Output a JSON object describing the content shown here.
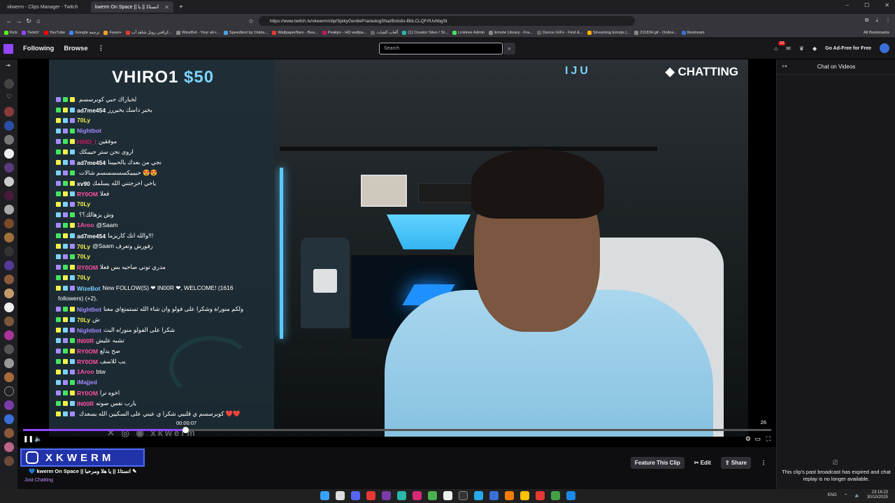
{
  "browser": {
    "tabs": [
      {
        "label": "xkwerm - Clips Manager - Twitch",
        "active": false
      },
      {
        "label": "kwerm On Space || انستا1 || يا",
        "active": true
      }
    ],
    "url": "https://www.twitch.tv/xkwerm/clip/SpikyGentlePrariedogShazBotstix-BbLCLQFrfUvhbgSt",
    "bookmarks": [
      "Kick",
      "Twitch'",
      "YouTube",
      "Google ترجمة",
      "Fasel+",
      "كرافتي روبل شاهد أب...",
      "WizeBot - Your all-i...",
      "Speedtest by Ookla...",
      "Wallpaperflare - Bea...",
      "Peakpx - HD wallpa...",
      "ألعاب الشات",
      "(1) Creator Sites / St...",
      "Linktree Admin",
      "Emote Library - Fra...",
      "Dance GIFs - Find &...",
      "Streaming Emojis |...",
      "211834.gif - Online...",
      "Restream"
    ],
    "all_bookmarks": "All Bookmarks"
  },
  "twitch_nav": {
    "following": "Following",
    "browse": "Browse",
    "more": "⋮",
    "search_placeholder": "Search",
    "notifications_count": "10",
    "ad_free": "Go Ad-Free for Free"
  },
  "overlay": {
    "title_name": "VHIRO1",
    "title_amount": "$50",
    "chatting_label": "CHATTING",
    "corner_mark": "IJU",
    "watermark": "xkwerm"
  },
  "chat_lines": [
    {
      "user": "",
      "msg": "لخباراك حبي كوبرسسم",
      "color": "#c2185b"
    },
    {
      "user": "ad7me454",
      "msg": "يخير داسك يخيررر",
      "color": "#ffffff"
    },
    {
      "user": "70Ly",
      "msg": "",
      "color": "#f2f24a"
    },
    {
      "user": "Nightbot",
      "msg": "",
      "color": "#a48bff"
    },
    {
      "user": "HIND_I",
      "msg": "موفقين",
      "color": "#c2185b"
    },
    {
      "user": "",
      "msg": "اروى نحن ستر حبيبكك",
      "color": "#c2185b"
    },
    {
      "user": "ad7me454",
      "msg": "نجي من بعدك يالحبيبنا",
      "color": "#ffffff"
    },
    {
      "user": "",
      "msg": "حبيبيكسسسسسم شالات 😍😍",
      "color": "#c2185b"
    },
    {
      "user": "xv90",
      "msg": "ياخي اخرجتني الله يسلمك",
      "color": "#ffffff"
    },
    {
      "user": "RY0OM",
      "msg": "فعلا",
      "color": "#ff4fa3"
    },
    {
      "user": "70Ly",
      "msg": "",
      "color": "#f2f24a"
    },
    {
      "user": "",
      "msg": "وش يزهالك؟؟",
      "color": "#c2185b"
    },
    {
      "user": "1Aroo",
      "msg": "@Saam",
      "color": "#ff4fa3"
    },
    {
      "user": "ad7me454",
      "msg": "والله انك كاريزما!!!",
      "color": "#ffffff"
    },
    {
      "user": "70Ly",
      "msg": "@Saam رفورش وتعرف",
      "color": "#f2f24a"
    },
    {
      "user": "70Ly",
      "msg": "",
      "color": "#f2f24a"
    },
    {
      "user": "RY0OM",
      "msg": "مدري توني صاحيه بس فعلا",
      "color": "#ff4fa3"
    },
    {
      "user": "70Ly",
      "msg": "",
      "color": "#f2f24a"
    },
    {
      "user": "WizeBot",
      "msg": "New FOLLOW(S) ❤ IN00R ❤, WELCOME! (1616",
      "color": "#7cd3ff"
    },
    {
      "user": "",
      "msg": "followers) (+2).",
      "color": "#ffffff"
    },
    {
      "user": "Nightbot",
      "msg": "ولكم منور/ة وشكرا على فولو وان شاء الله تستمتع/ي معنا",
      "color": "#a48bff"
    },
    {
      "user": "70Ly",
      "msg": "ش",
      "color": "#f2f24a"
    },
    {
      "user": "Nightbot",
      "msg": "شكرا على الفولو منور/ه البث",
      "color": "#a48bff"
    },
    {
      "user": "IN00R",
      "msg": "تشبه عليش",
      "color": "#ff4fa3"
    },
    {
      "user": "RY0OM",
      "msg": "صح يدلع",
      "color": "#ff4fa3"
    },
    {
      "user": "RY0OM",
      "msg": "يب للاسف",
      "color": "#ff4fa3"
    },
    {
      "user": "1Aroo",
      "msg": "btw",
      "color": "#ff4fa3"
    },
    {
      "user": "iMajjed",
      "msg": "",
      "color": "#a48bff"
    },
    {
      "user": "RY0OM",
      "msg": "اخوه ترا",
      "color": "#ff4fa3"
    },
    {
      "user": "IN00R",
      "msg": "يارب نفس صوته",
      "color": "#ff4fa3"
    },
    {
      "user": "",
      "msg": "كوبرسسم ي قلبيي شكرا ي عيني على السكيين الله يسعدك ❤️❤️",
      "color": "#c2185b"
    }
  ],
  "player": {
    "timecode": "00:00:07",
    "right_count": "26",
    "progress": 0.22
  },
  "clip_info": {
    "brand": "XKWERM",
    "title": "kwerm On Space || انستا1 || يا هلا ومرحبا",
    "category": "Just Chatting",
    "feature_label": "Feature This Clip",
    "edit_label": "Edit",
    "share_label": "Share"
  },
  "chat_side": {
    "header": "Chat on Videos",
    "expired_msg": "This clip's past broadcast has expired and chat replay is no longer available."
  },
  "taskbar": {
    "lang": "ENG",
    "time": "23:16:23",
    "date": "30/10/2025"
  }
}
